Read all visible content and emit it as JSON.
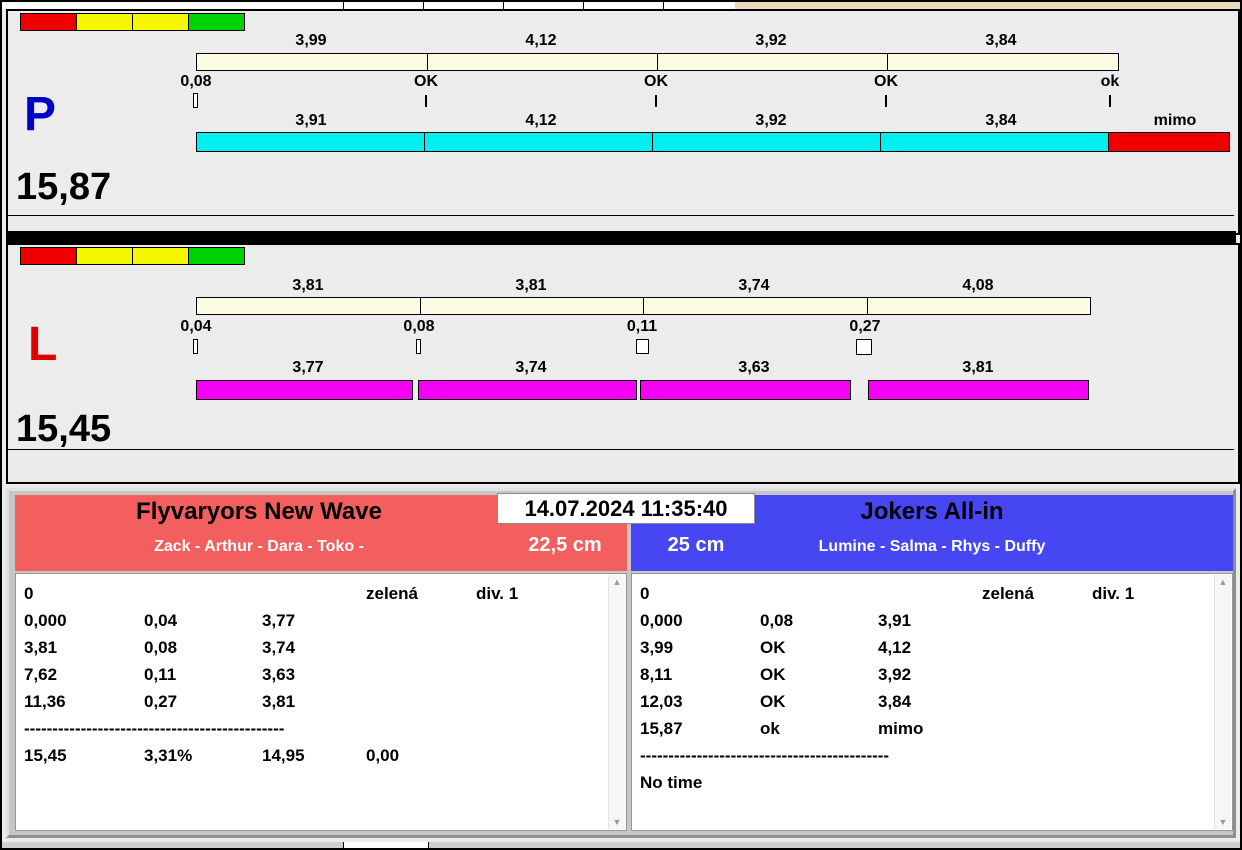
{
  "icons": {
    "scroll_up": "▲",
    "scroll_down": "▼"
  },
  "panel_p": {
    "label": "P",
    "letter_color": "#0000c8",
    "time": "15,87",
    "status_colors": [
      "#f20000",
      "#f7f700",
      "#f7f700",
      "#00d400"
    ],
    "splits_top": [
      "3,99",
      "4,12",
      "3,92",
      "3,84"
    ],
    "start_mark": "0,08",
    "gate_marks": [
      "OK",
      "OK",
      "OK",
      "ok"
    ],
    "splits_bottom": [
      "3,91",
      "4,12",
      "3,92",
      "3,84"
    ],
    "overflow_label": "mimo",
    "bar_color": "#00efef",
    "overflow_color": "#f20000"
  },
  "panel_l": {
    "label": "L",
    "letter_color": "#e00000",
    "time": "15,45",
    "status_colors": [
      "#f20000",
      "#f7f700",
      "#f7f700",
      "#00d400"
    ],
    "splits_top": [
      "3,81",
      "3,81",
      "3,74",
      "4,08"
    ],
    "gate_marks": [
      "0,04",
      "0,08",
      "0,11",
      "0,27"
    ],
    "splits_bottom": [
      "3,77",
      "3,74",
      "3,63",
      "3,81"
    ],
    "bar_color": "#f400f4"
  },
  "scoreboard": {
    "datetime": "14.07.2024 11:35:40",
    "left": {
      "team": "Flyvaryors New Wave",
      "members": "Zack - Arthur - Dara - Toko -",
      "category": "22,5 cm",
      "header_color": "#f25f5e",
      "rows": [
        [
          "0",
          "",
          "",
          "zelená",
          "div. 1"
        ],
        [
          "0,000",
          "0,04",
          "3,77",
          "",
          ""
        ],
        [
          "3,81",
          "0,08",
          "3,74",
          "",
          ""
        ],
        [
          "7,62",
          "0,11",
          "3,63",
          "",
          ""
        ],
        [
          "11,36",
          "0,27",
          "3,81",
          "",
          ""
        ],
        [
          "----------------------------------------------",
          "",
          "",
          "",
          ""
        ],
        [
          "15,45",
          "3,31%",
          "14,95",
          "0,00",
          ""
        ]
      ]
    },
    "right": {
      "team": "Jokers All-in",
      "members": "Lumine - Salma - Rhys - Duffy",
      "category": "25 cm",
      "header_color": "#4646f2",
      "rows": [
        [
          "0",
          "",
          "",
          "zelená",
          "div. 1"
        ],
        [
          "0,000",
          "0,08",
          "3,91",
          "",
          ""
        ],
        [
          "3,99",
          "OK",
          "4,12",
          "",
          ""
        ],
        [
          "8,11",
          "OK",
          "3,92",
          "",
          ""
        ],
        [
          "12,03",
          "OK",
          "3,84",
          "",
          ""
        ],
        [
          "15,87",
          "ok",
          "mimo",
          "",
          ""
        ],
        [
          "--------------------------------------------",
          "",
          "",
          "",
          ""
        ],
        [
          "No time",
          "",
          "",
          "",
          ""
        ]
      ]
    }
  }
}
